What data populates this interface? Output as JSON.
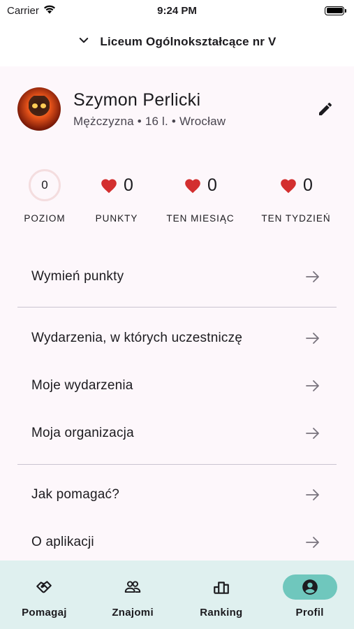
{
  "status_bar": {
    "carrier": "Carrier",
    "time": "9:24 PM"
  },
  "header": {
    "school": "Liceum Ogólnokształcące nr V",
    "icon": "chevron-down-icon"
  },
  "profile": {
    "name": "Szymon Perlicki",
    "meta": "Mężczyzna • 16 l. • Wrocław"
  },
  "stats": {
    "level": {
      "value": "0",
      "label": "POZIOM"
    },
    "points": {
      "value": "0",
      "label": "PUNKTY"
    },
    "month": {
      "value": "0",
      "label": "TEN MIESIĄC"
    },
    "week": {
      "value": "0",
      "label": "TEN TYDZIEŃ"
    },
    "heart_color": "#d32f2f"
  },
  "menu": {
    "items": [
      {
        "label": "Wymień punkty"
      },
      {
        "label": "Wydarzenia, w których uczestniczę"
      },
      {
        "label": "Moje wydarzenia"
      },
      {
        "label": "Moja organizacja"
      },
      {
        "label": "Jak pomagać?"
      },
      {
        "label": "O aplikacji"
      }
    ]
  },
  "nav": {
    "items": [
      {
        "label": "Pomagaj",
        "icon": "handshake-icon"
      },
      {
        "label": "Znajomi",
        "icon": "people-icon"
      },
      {
        "label": "Ranking",
        "icon": "ranking-icon"
      },
      {
        "label": "Profil",
        "icon": "account-circle-icon",
        "active": true
      }
    ],
    "active_color": "#6fc7bd",
    "background": "#dff0ef"
  }
}
